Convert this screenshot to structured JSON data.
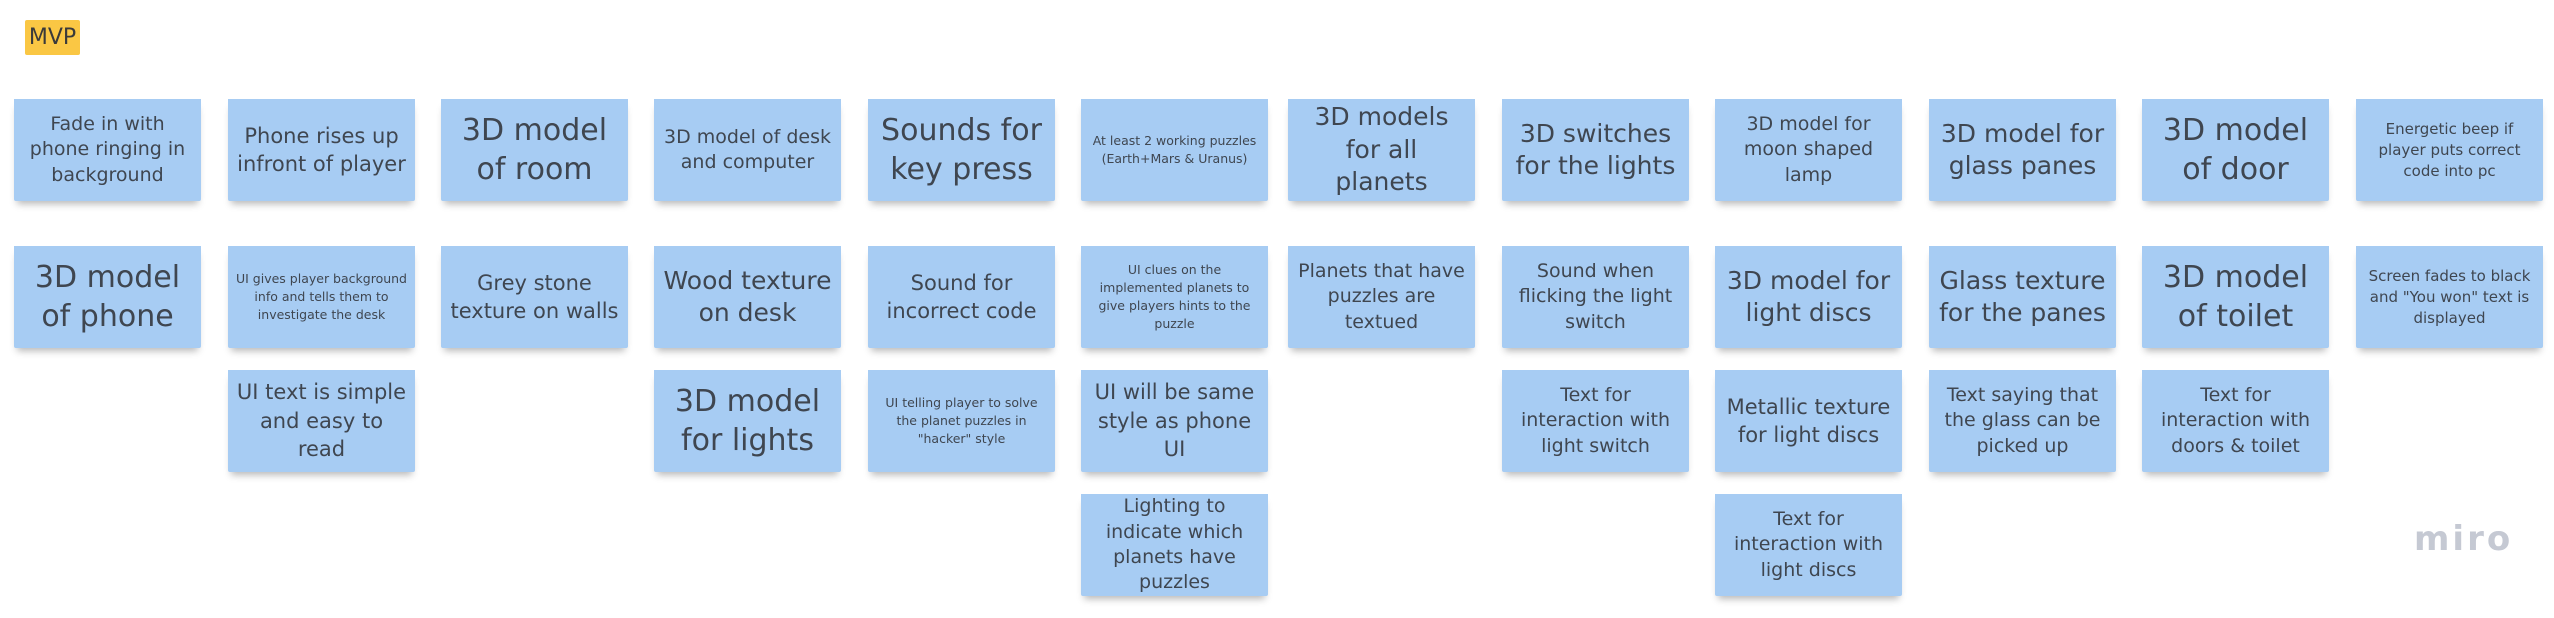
{
  "frame": {
    "label": "MVP"
  },
  "logo": "miro",
  "columns": [
    {
      "notes": [
        {
          "text": "Fade in with phone ringing in background",
          "size": "s"
        },
        {
          "text": "3D model of phone",
          "size": "xl"
        }
      ]
    },
    {
      "notes": [
        {
          "text": "Phone rises up infront of player",
          "size": "m"
        },
        {
          "text": "UI gives player background info and tells them to investigate the desk",
          "size": "tiny"
        },
        {
          "text": "UI text is simple and easy to read",
          "size": "m"
        }
      ]
    },
    {
      "notes": [
        {
          "text": "3D model of room",
          "size": "xl"
        },
        {
          "text": "Grey stone texture on walls",
          "size": "m"
        }
      ]
    },
    {
      "notes": [
        {
          "text": "3D model of desk and computer",
          "size": "s"
        },
        {
          "text": "Wood texture on desk",
          "size": "l"
        },
        {
          "text": "3D model for lights",
          "size": "xl"
        }
      ]
    },
    {
      "notes": [
        {
          "text": "Sounds for key press",
          "size": "xl"
        },
        {
          "text": "Sound for incorrect code",
          "size": "m"
        },
        {
          "text": "UI telling player to solve the planet puzzles in \"hacker\" style",
          "size": "tiny"
        }
      ]
    },
    {
      "notes": [
        {
          "text": "At least 2 working puzzles (Earth+Mars & Uranus)",
          "size": "tiny"
        },
        {
          "text": "UI clues on the implemented planets to give players hints to the puzzle",
          "size": "tiny"
        },
        {
          "text": "UI will be same style as phone UI",
          "size": "m"
        },
        {
          "text": "Lighting to indicate which planets have puzzles",
          "size": "s"
        }
      ]
    },
    {
      "notes": [
        {
          "text": "3D models for all planets",
          "size": "l"
        },
        {
          "text": "Planets that have puzzles are textued",
          "size": "s"
        }
      ]
    },
    {
      "notes": [
        {
          "text": "3D switches for the lights",
          "size": "l"
        },
        {
          "text": "Sound when flicking the light switch",
          "size": "s"
        },
        {
          "text": "Text for interaction with light switch",
          "size": "s"
        }
      ]
    },
    {
      "notes": [
        {
          "text": "3D model for moon shaped lamp",
          "size": "s"
        },
        {
          "text": "3D model for light discs",
          "size": "l"
        },
        {
          "text": "Metallic texture for light discs",
          "size": "m"
        },
        {
          "text": "Text for interaction with light discs",
          "size": "s"
        }
      ]
    },
    {
      "notes": [
        {
          "text": "3D model for glass panes",
          "size": "l"
        },
        {
          "text": "Glass texture for the panes",
          "size": "l"
        },
        {
          "text": "Text saying that the glass can be picked up",
          "size": "s"
        }
      ]
    },
    {
      "notes": [
        {
          "text": "3D model of door",
          "size": "xl"
        },
        {
          "text": "3D model of toilet",
          "size": "xl"
        },
        {
          "text": "Text for interaction with doors & toilet",
          "size": "s"
        }
      ]
    },
    {
      "notes": [
        {
          "text": "Energetic beep if player puts correct code into pc",
          "size": "xs"
        },
        {
          "text": "Screen fades to black and \"You won\" text is displayed",
          "size": "xs"
        }
      ]
    }
  ],
  "colors": {
    "note": "#a7ccf3",
    "note_text": "#3f4650",
    "frame_label": "#fac744",
    "logo": "#c5c9d3"
  }
}
